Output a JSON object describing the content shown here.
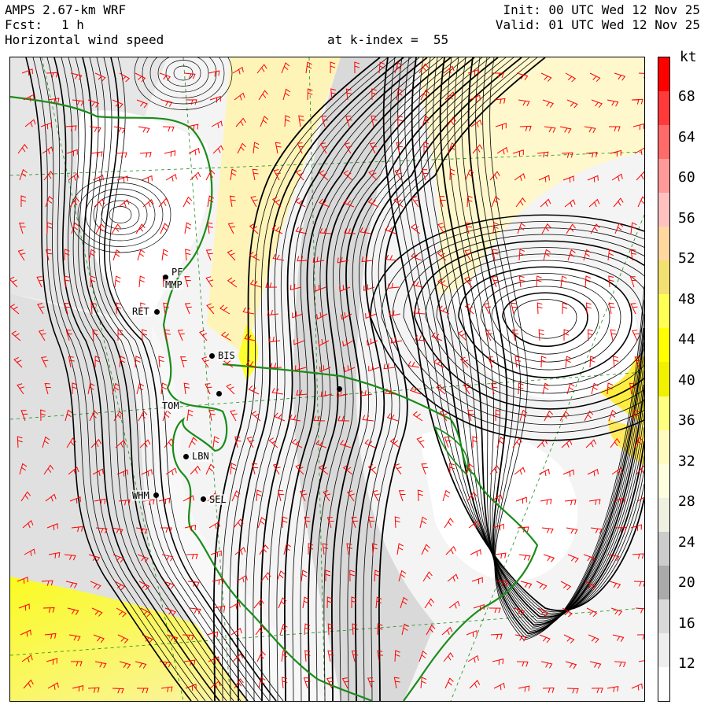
{
  "header": {
    "model": "AMPS 2.67-km WRF",
    "forecast_label": "Fcst:",
    "forecast_value": "1 h",
    "field": "Horizontal wind speed",
    "level": "at k-index =  55",
    "init": "Init: 00 UTC Wed 12 Nov 25",
    "valid": "Valid: 01 UTC Wed 12 Nov 25"
  },
  "colorbar": {
    "unit": "kt",
    "ticks": [
      "68",
      "64",
      "60",
      "56",
      "52",
      "48",
      "44",
      "40",
      "36",
      "32",
      "28",
      "24",
      "20",
      "16",
      "12"
    ],
    "colors": [
      "#ff0000",
      "#ff3a3a",
      "#ff6a6a",
      "#ff9a9a",
      "#ffc0c0",
      "#ffd8a0",
      "#f2e070",
      "#ffff55",
      "#ffff00",
      "#f0f000",
      "#ffff80",
      "#fffac0",
      "#fffde0",
      "#f0f0e0",
      "#cccccc",
      "#aaaaaa",
      "#d9d9d9",
      "#eeeeee",
      "#ffffff"
    ]
  },
  "stations": [
    {
      "id": "PF",
      "label": "PF"
    },
    {
      "id": "MMP",
      "label": "MMP"
    },
    {
      "id": "RET",
      "label": "RET"
    },
    {
      "id": "BIS",
      "label": "BIS"
    },
    {
      "id": "TOM",
      "label": "TOM"
    },
    {
      "id": "LBN",
      "label": "LBN"
    },
    {
      "id": "WHM",
      "label": "WHM"
    },
    {
      "id": "SEL",
      "label": "SEL"
    }
  ],
  "colors": {
    "coastline": "#1a8c1a",
    "barbs": "#ff0000",
    "streamlines": "#000000",
    "grid": "#1a8c1a"
  }
}
